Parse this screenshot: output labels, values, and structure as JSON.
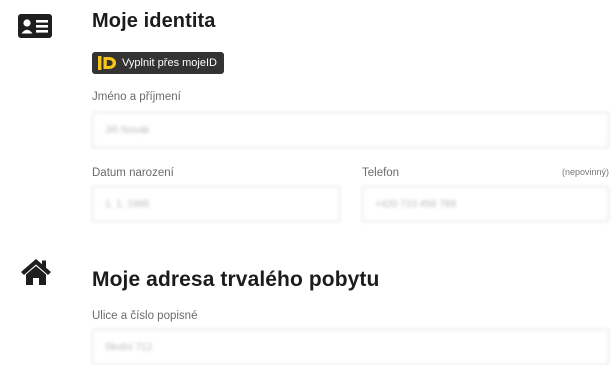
{
  "identity": {
    "title": "Moje identita",
    "icon": "id-card-icon",
    "mojeid_button": {
      "label": "Vyplnit přes mojeID",
      "logo": "mojeid-logo-icon",
      "logo_color": "#f5c518"
    },
    "name": {
      "label": "Jméno a příjmení",
      "value": "Jiří Novák"
    },
    "birth_date": {
      "label": "Datum narození",
      "value": "1. 1. 1985"
    },
    "phone": {
      "label": "Telefon",
      "note": "(nepovinný)",
      "value": "+420 723 456 789"
    }
  },
  "address": {
    "title": "Moje adresa trvalého pobytu",
    "icon": "home-icon",
    "street": {
      "label": "Ulice a číslo popisné",
      "value": "Školní 712"
    }
  }
}
